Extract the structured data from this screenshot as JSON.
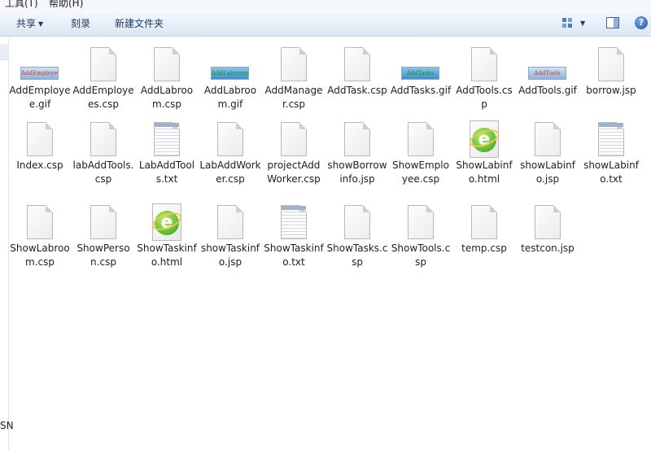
{
  "menu": {
    "tools": "工具(T)",
    "help": "帮助(H)"
  },
  "toolbar": {
    "share": "共享",
    "burn": "刻录",
    "new_folder": "新建文件夹",
    "help_glyph": "?"
  },
  "navpane": {
    "cut_text": "SN"
  },
  "icons": {
    "blank": "document-icon",
    "txt": "text-document-icon",
    "gif": "gif-image-icon",
    "html": "html-document-icon"
  },
  "files": [
    {
      "name": "AddEmployee.gif",
      "type": "gif",
      "thumb": "AddEmployee"
    },
    {
      "name": "AddEmployees.csp",
      "type": "blank"
    },
    {
      "name": "AddLabroom.csp",
      "type": "blank"
    },
    {
      "name": "AddLabroom.gif",
      "type": "gif",
      "thumb": "AddLabroom"
    },
    {
      "name": "AddManager.csp",
      "type": "blank"
    },
    {
      "name": "AddTask.csp",
      "type": "blank"
    },
    {
      "name": "AddTasks.gif",
      "type": "gif",
      "thumb": "AddTasks"
    },
    {
      "name": "AddTools.csp",
      "type": "blank"
    },
    {
      "name": "AddTools.gif",
      "type": "gif",
      "thumb": "AddTools"
    },
    {
      "name": "borrow.jsp",
      "type": "blank"
    },
    {
      "name": "Index.csp",
      "type": "blank"
    },
    {
      "name": "labAddTools.csp",
      "type": "blank"
    },
    {
      "name": "LabAddTools.txt",
      "type": "txt"
    },
    {
      "name": "LabAddWorker.csp",
      "type": "blank"
    },
    {
      "name": "projectAddWorker.csp",
      "type": "blank"
    },
    {
      "name": "showBorrowinfo.jsp",
      "type": "blank"
    },
    {
      "name": "ShowEmployee.csp",
      "type": "blank"
    },
    {
      "name": "ShowLabinfo.html",
      "type": "html"
    },
    {
      "name": "showLabinfo.jsp",
      "type": "blank"
    },
    {
      "name": "showLabinfo.txt",
      "type": "txt"
    },
    {
      "name": "ShowLabroom.csp",
      "type": "blank"
    },
    {
      "name": "ShowPerson.csp",
      "type": "blank"
    },
    {
      "name": "ShowTaskinfo.html",
      "type": "html"
    },
    {
      "name": "showTaskinfo.jsp",
      "type": "blank"
    },
    {
      "name": "ShowTaskinfo.txt",
      "type": "txt"
    },
    {
      "name": "ShowTasks.csp",
      "type": "blank"
    },
    {
      "name": "ShowTools.csp",
      "type": "blank"
    },
    {
      "name": "temp.csp",
      "type": "blank"
    },
    {
      "name": "testcon.jsp",
      "type": "blank"
    }
  ]
}
